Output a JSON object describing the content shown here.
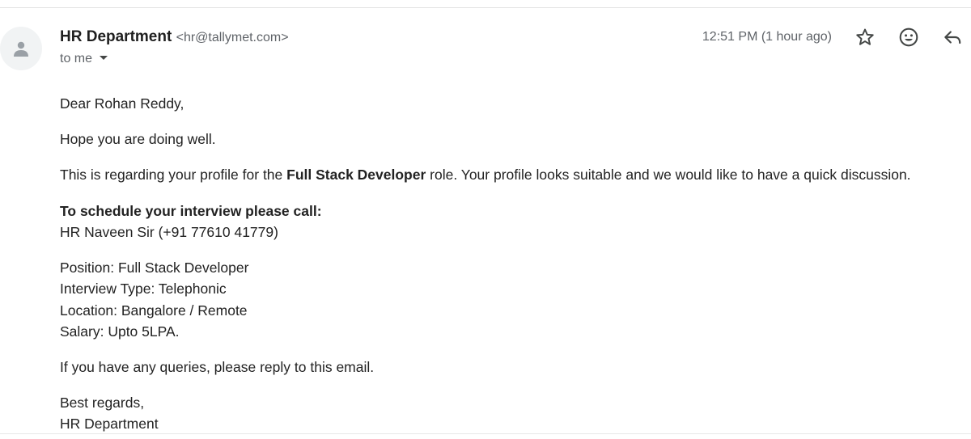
{
  "email": {
    "sender_name": "HR Department",
    "sender_email": "<hr@tallymet.com>",
    "recipient_label": "to me",
    "timestamp": "12:51 PM (1 hour ago)"
  },
  "icons": {
    "avatar": "person-icon",
    "star": "star-icon",
    "emoji": "emoji-icon",
    "reply": "reply-icon"
  },
  "body": {
    "greeting": "Dear Rohan Reddy,",
    "hope": "Hope you are doing well.",
    "regarding_pre": "This is regarding your profile for the ",
    "role": "Full Stack Developer",
    "regarding_post": " role. Your profile looks suitable and we would like to have a quick discussion.",
    "schedule_heading": "To schedule your interview please call:",
    "contact": "HR Naveen Sir (+91 77610 41779)",
    "position": "Position: Full Stack Developer",
    "interview_type": "Interview Type: Telephonic",
    "location": "Location: Bangalore / Remote",
    "salary": "Salary: Upto 5LPA.",
    "queries": "If you have any queries, please reply to this email.",
    "signoff": "Best regards,",
    "signature": "HR Department"
  }
}
